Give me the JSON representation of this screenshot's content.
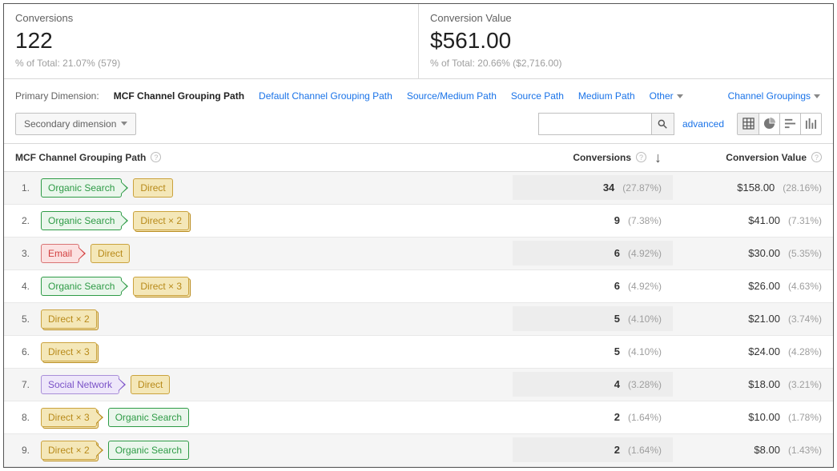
{
  "scorecards": {
    "conversions": {
      "label": "Conversions",
      "value": "122",
      "subtext": "% of Total: 21.07% (579)"
    },
    "conv_value": {
      "label": "Conversion Value",
      "value": "$561.00",
      "subtext": "% of Total: 20.66% ($2,716.00)"
    }
  },
  "dimbar": {
    "label": "Primary Dimension:",
    "active": "MCF Channel Grouping Path",
    "links": [
      "Default Channel Grouping Path",
      "Source/Medium Path",
      "Source Path",
      "Medium Path",
      "Other"
    ],
    "channel_groupings": "Channel Groupings"
  },
  "toolbar": {
    "secondary": "Secondary dimension",
    "advanced": "advanced",
    "search_placeholder": ""
  },
  "thead": {
    "path": "MCF Channel Grouping Path",
    "conversions": "Conversions",
    "conv_value": "Conversion Value"
  },
  "chip_labels": {
    "organic": "Organic Search",
    "direct": "Direct",
    "direct_x2": "Direct × 2",
    "direct_x3": "Direct × 3",
    "email": "Email",
    "social": "Social Network"
  },
  "rows": [
    {
      "idx": "1.",
      "path": [
        [
          "organic",
          "organic",
          true,
          false
        ],
        [
          "direct",
          "direct",
          false,
          false
        ]
      ],
      "conv": "34",
      "conv_pct": "(27.87%)",
      "val": "$158.00",
      "val_pct": "(28.16%)"
    },
    {
      "idx": "2.",
      "path": [
        [
          "organic",
          "organic",
          true,
          false
        ],
        [
          "direct",
          "direct_x2",
          false,
          true
        ]
      ],
      "conv": "9",
      "conv_pct": "(7.38%)",
      "val": "$41.00",
      "val_pct": "(7.31%)"
    },
    {
      "idx": "3.",
      "path": [
        [
          "email",
          "email",
          true,
          false
        ],
        [
          "direct",
          "direct",
          false,
          false
        ]
      ],
      "conv": "6",
      "conv_pct": "(4.92%)",
      "val": "$30.00",
      "val_pct": "(5.35%)"
    },
    {
      "idx": "4.",
      "path": [
        [
          "organic",
          "organic",
          true,
          false
        ],
        [
          "direct",
          "direct_x3",
          false,
          true
        ]
      ],
      "conv": "6",
      "conv_pct": "(4.92%)",
      "val": "$26.00",
      "val_pct": "(4.63%)"
    },
    {
      "idx": "5.",
      "path": [
        [
          "direct",
          "direct_x2",
          false,
          true
        ]
      ],
      "conv": "5",
      "conv_pct": "(4.10%)",
      "val": "$21.00",
      "val_pct": "(3.74%)"
    },
    {
      "idx": "6.",
      "path": [
        [
          "direct",
          "direct_x3",
          false,
          true
        ]
      ],
      "conv": "5",
      "conv_pct": "(4.10%)",
      "val": "$24.00",
      "val_pct": "(4.28%)"
    },
    {
      "idx": "7.",
      "path": [
        [
          "social",
          "social",
          true,
          false
        ],
        [
          "direct",
          "direct",
          false,
          false
        ]
      ],
      "conv": "4",
      "conv_pct": "(3.28%)",
      "val": "$18.00",
      "val_pct": "(3.21%)"
    },
    {
      "idx": "8.",
      "path": [
        [
          "direct",
          "direct_x3",
          true,
          true
        ],
        [
          "organic",
          "organic",
          false,
          false
        ]
      ],
      "conv": "2",
      "conv_pct": "(1.64%)",
      "val": "$10.00",
      "val_pct": "(1.78%)"
    },
    {
      "idx": "9.",
      "path": [
        [
          "direct",
          "direct_x2",
          true,
          true
        ],
        [
          "organic",
          "organic",
          false,
          false
        ]
      ],
      "conv": "2",
      "conv_pct": "(1.64%)",
      "val": "$8.00",
      "val_pct": "(1.43%)"
    }
  ]
}
